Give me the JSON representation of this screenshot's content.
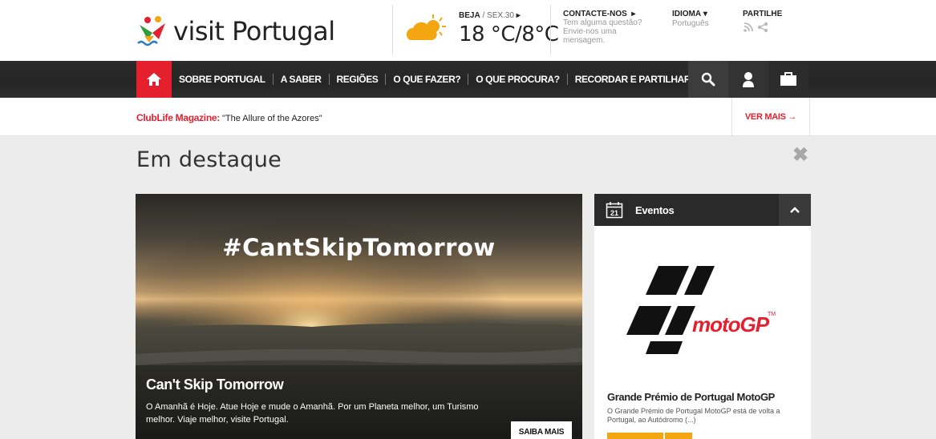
{
  "brand": {
    "logo_text": "visit Portugal",
    "colors": {
      "accent": "#e5202e",
      "nav_bg": "#2b2b2b",
      "event_button": "#f3a612"
    }
  },
  "weather": {
    "location": "BEJA",
    "date": " / SEX.30",
    "arrow": "▸",
    "temperature": "18 °C/8°C",
    "icon": "partly-cloudy-icon"
  },
  "contact": {
    "title": "CONTACTE-NOS",
    "arrow": "▸",
    "line1": "Tem alguma questão?",
    "line2": "Envie-nos uma",
    "line3": "mensagem."
  },
  "language": {
    "title": "IDIOMA",
    "caret": "▾",
    "value": "Português"
  },
  "share": {
    "title": "PARTILHE",
    "icons": [
      "rss-icon",
      "share-icon"
    ]
  },
  "nav": {
    "home_icon": "home-icon",
    "items": [
      "SOBRE PORTUGAL",
      "A SABER",
      "REGIÕES",
      "O QUE FAZER?",
      "O QUE PROCURA?",
      "RECORDAR E PARTILHAR"
    ],
    "tools": [
      "search-icon",
      "user-icon",
      "briefcase-icon"
    ]
  },
  "ticker": {
    "brand": "ClubLife Magazine:",
    "text": " \"The Allure of the Azores\"",
    "more": "VER MAIS →"
  },
  "section": {
    "title": "Em destaque",
    "close": "✖"
  },
  "hero": {
    "hashtag": "#CantSkipTomorrow",
    "title": "Can't Skip Tomorrow",
    "description": "O Amanhã é Hoje. Atue Hoje e mude o Amanhã. Por um Planeta melhor, um Turismo melhor. Viaje melhor, visite Portugal.",
    "button": "SAIBA MAIS"
  },
  "events": {
    "calendar_day": "21",
    "title": "Eventos",
    "logo_text": "motoGP",
    "logo_tm": "TM",
    "event_title": "Grande Prémio de Portugal MotoGP",
    "event_desc": "O Grande Prémio de Portugal MotoGP está de volta a Portugal, ao Autódromo (...)"
  }
}
